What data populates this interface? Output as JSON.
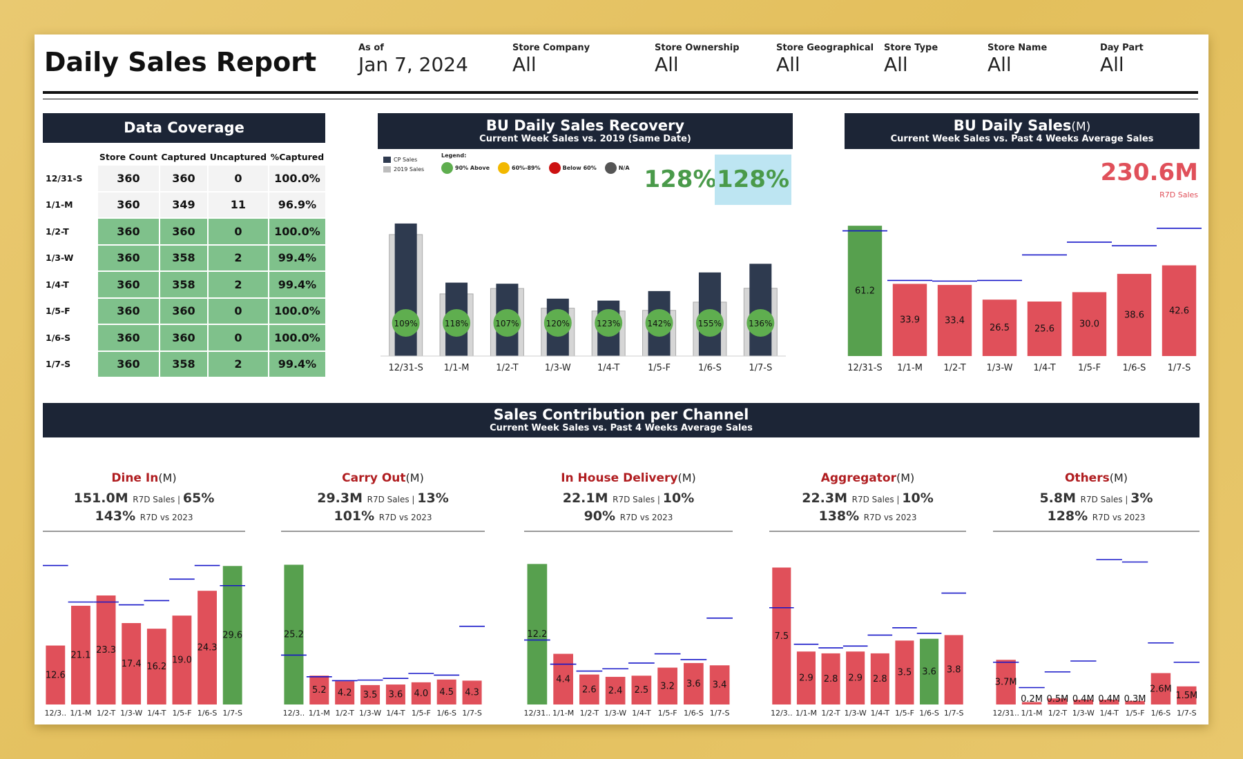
{
  "header": {
    "title": "Daily Sales Report",
    "filters": [
      {
        "label": "As of",
        "value": "Jan 7, 2024"
      },
      {
        "label": "Store Company",
        "value": "All"
      },
      {
        "label": "Store Ownership",
        "value": "All"
      },
      {
        "label": "Store Geographical",
        "value": "All"
      },
      {
        "label": "Store Type",
        "value": "All"
      },
      {
        "label": "Store Name",
        "value": "All"
      },
      {
        "label": "Day Part",
        "value": "All"
      }
    ]
  },
  "coverage": {
    "title": "Data Coverage",
    "columns": [
      "Store Count",
      "Captured",
      "Uncaptured",
      "%Captured"
    ],
    "rows": [
      {
        "day": "12/31-S",
        "values": [
          "360",
          "360",
          "0",
          "100.0%"
        ],
        "highlight": false
      },
      {
        "day": "1/1-M",
        "values": [
          "360",
          "349",
          "11",
          "96.9%"
        ],
        "highlight": false
      },
      {
        "day": "1/2-T",
        "values": [
          "360",
          "360",
          "0",
          "100.0%"
        ],
        "highlight": true
      },
      {
        "day": "1/3-W",
        "values": [
          "360",
          "358",
          "2",
          "99.4%"
        ],
        "highlight": true
      },
      {
        "day": "1/4-T",
        "values": [
          "360",
          "358",
          "2",
          "99.4%"
        ],
        "highlight": true
      },
      {
        "day": "1/5-F",
        "values": [
          "360",
          "360",
          "0",
          "100.0%"
        ],
        "highlight": true
      },
      {
        "day": "1/6-S",
        "values": [
          "360",
          "360",
          "0",
          "100.0%"
        ],
        "highlight": true
      },
      {
        "day": "1/7-S",
        "values": [
          "360",
          "358",
          "2",
          "99.4%"
        ],
        "highlight": true
      }
    ]
  },
  "recovery": {
    "title": "BU Daily Sales Recovery",
    "subtitle": "Current Week Sales vs. 2019 (Same Date)",
    "kpi_left": "128%",
    "kpi_right": "128%",
    "series_legend": [
      "CP Sales",
      "2019 Sales"
    ],
    "legend_title": "Legend:",
    "legend_items": [
      {
        "label": "90% Above",
        "color": "#5fae4f"
      },
      {
        "label": "60%-89%",
        "color": "#f2b800"
      },
      {
        "label": "Below 60%",
        "color": "#cc1111"
      },
      {
        "label": "N/A",
        "color": "#555555"
      }
    ]
  },
  "daily_sales": {
    "title": "BU Daily Sales",
    "unit": "(M)",
    "subtitle": "Current Week Sales vs. Past 4 Weeks Average Sales",
    "kpi": "230.6M",
    "kpi_label": "R7D Sales"
  },
  "channels_section": {
    "title": "Sales Contribution per Channel",
    "subtitle": "Current Week Sales vs. Past 4 Weeks Average Sales"
  },
  "channels": [
    {
      "name": "Dine In",
      "unit": "(M)",
      "sales": "151.0M",
      "sales_label": "R7D Sales",
      "share": "65%",
      "vs": "143%",
      "vs_label": "R7D vs 2023"
    },
    {
      "name": "Carry Out",
      "unit": "(M)",
      "sales": "29.3M",
      "sales_label": "R7D Sales",
      "share": "13%",
      "vs": "101%",
      "vs_label": "R7D vs 2023"
    },
    {
      "name": "In House Delivery",
      "unit": "(M)",
      "sales": "22.1M",
      "sales_label": "R7D Sales",
      "share": "10%",
      "vs": "90%",
      "vs_label": "R7D vs 2023"
    },
    {
      "name": "Aggregator",
      "unit": "(M)",
      "sales": "22.3M",
      "sales_label": "R7D Sales",
      "share": "10%",
      "vs": "138%",
      "vs_label": "R7D vs 2023"
    },
    {
      "name": "Others",
      "unit": "(M)",
      "sales": "5.8M",
      "sales_label": "R7D Sales",
      "share": "3%",
      "vs": "128%",
      "vs_label": "R7D vs 2023"
    }
  ],
  "chart_data": [
    {
      "id": "recovery",
      "type": "bar",
      "title": "BU Daily Sales Recovery",
      "categories": [
        "12/31-S",
        "1/1-M",
        "1/2-T",
        "1/3-W",
        "1/4-T",
        "1/5-F",
        "1/6-S",
        "1/7-S"
      ],
      "series": [
        {
          "name": "CP Sales",
          "values": [
            61.2,
            33.9,
            33.4,
            26.5,
            25.6,
            30.0,
            38.6,
            42.6
          ],
          "color": "#2e3a4f"
        },
        {
          "name": "2019 Sales",
          "values": [
            56.1,
            28.7,
            31.2,
            22.1,
            20.8,
            21.1,
            24.9,
            31.3
          ],
          "color": "#d4d4d4"
        }
      ],
      "labels": [
        "109%",
        "118%",
        "107%",
        "120%",
        "123%",
        "142%",
        "155%",
        "136%"
      ],
      "label_color": "#5fae4f",
      "ylim": [
        0,
        65
      ]
    },
    {
      "id": "daily",
      "type": "bar",
      "title": "BU Daily Sales",
      "categories": [
        "12/31-S",
        "1/1-M",
        "1/2-T",
        "1/3-W",
        "1/4-T",
        "1/5-F",
        "1/6-S",
        "1/7-S"
      ],
      "values": [
        61.2,
        33.9,
        33.4,
        26.5,
        25.6,
        30.0,
        38.6,
        42.6
      ],
      "labels": [
        "61.2",
        "33.9",
        "33.4",
        "26.5",
        "25.6",
        "30.0",
        "38.6",
        "42.6"
      ],
      "reference": [
        58.8,
        35.5,
        35.2,
        35.5,
        47.5,
        53.5,
        51.8,
        60.0
      ],
      "colors": [
        "#57a04e",
        "#e0505a",
        "#e0505a",
        "#e0505a",
        "#e0505a",
        "#e0505a",
        "#e0505a",
        "#e0505a"
      ],
      "ylim": [
        0,
        70
      ]
    },
    {
      "id": "dinein",
      "type": "bar",
      "categories": [
        "12/3..",
        "1/1-M",
        "1/2-T",
        "1/3-W",
        "1/4-T",
        "1/5-F",
        "1/6-S",
        "1/7-S"
      ],
      "values": [
        12.6,
        21.1,
        23.3,
        17.4,
        16.2,
        19.0,
        24.3,
        29.6
      ],
      "labels": [
        "12.6",
        "21.1",
        "23.3",
        "17.4",
        "16.2",
        "19.0",
        "24.3",
        "29.6"
      ],
      "reference": [
        29.7,
        21.9,
        21.9,
        21.3,
        22.2,
        26.8,
        29.7,
        25.4
      ],
      "colors": [
        "#e0505a",
        "#e0505a",
        "#e0505a",
        "#e0505a",
        "#e0505a",
        "#e0505a",
        "#e0505a",
        "#57a04e"
      ],
      "ylim": [
        0,
        32
      ]
    },
    {
      "id": "carryout",
      "type": "bar",
      "categories": [
        "12/3..",
        "1/1-M",
        "1/2-T",
        "1/3-W",
        "1/4-T",
        "1/5-F",
        "1/6-S",
        "1/7-S"
      ],
      "values": [
        25.2,
        5.2,
        4.2,
        3.5,
        3.6,
        4.0,
        4.5,
        4.3
      ],
      "labels": [
        "25.2",
        "5.2",
        "4.2",
        "3.5",
        "3.6",
        "4.0",
        "4.5",
        "4.3"
      ],
      "reference": [
        8.9,
        5.0,
        4.3,
        4.4,
        4.7,
        5.6,
        5.3,
        14.1
      ],
      "colors": [
        "#57a04e",
        "#e0505a",
        "#e0505a",
        "#e0505a",
        "#e0505a",
        "#e0505a",
        "#e0505a",
        "#e0505a"
      ],
      "ylim": [
        0,
        27
      ]
    },
    {
      "id": "inhouse",
      "type": "bar",
      "categories": [
        "12/31..",
        "1/1-M",
        "1/2-T",
        "1/3-W",
        "1/4-T",
        "1/5-F",
        "1/6-S",
        "1/7-S"
      ],
      "values": [
        12.2,
        4.4,
        2.6,
        2.4,
        2.5,
        3.2,
        3.6,
        3.4
      ],
      "labels": [
        "12.2",
        "4.4",
        "2.6",
        "2.4",
        "2.5",
        "3.2",
        "3.6",
        "3.4"
      ],
      "reference": [
        5.6,
        3.5,
        2.9,
        3.1,
        3.6,
        4.4,
        3.9,
        7.5
      ],
      "colors": [
        "#57a04e",
        "#e0505a",
        "#e0505a",
        "#e0505a",
        "#e0505a",
        "#e0505a",
        "#e0505a",
        "#e0505a"
      ],
      "ylim": [
        0,
        13
      ]
    },
    {
      "id": "aggregator",
      "type": "bar",
      "categories": [
        "12/3..",
        "1/1-M",
        "1/2-T",
        "1/3-W",
        "1/4-T",
        "1/5-F",
        "1/6-S",
        "1/7-S"
      ],
      "values": [
        7.5,
        2.9,
        2.8,
        2.9,
        2.8,
        3.5,
        3.6,
        3.8
      ],
      "labels": [
        "7.5",
        "2.9",
        "2.8",
        "2.9",
        "2.8",
        "3.5",
        "3.6",
        "3.8"
      ],
      "reference": [
        5.3,
        3.3,
        3.1,
        3.2,
        3.8,
        4.2,
        3.9,
        6.1
      ],
      "colors": [
        "#e0505a",
        "#e0505a",
        "#e0505a",
        "#e0505a",
        "#e0505a",
        "#e0505a",
        "#57a04e",
        "#e0505a"
      ],
      "ylim": [
        0,
        8.2
      ]
    },
    {
      "id": "others",
      "type": "bar",
      "categories": [
        "12/31..",
        "1/1-M",
        "1/2-T",
        "1/3-W",
        "1/4-T",
        "1/5-F",
        "1/6-S",
        "1/7-S"
      ],
      "values": [
        3.7,
        0.2,
        0.5,
        0.4,
        0.4,
        0.3,
        2.6,
        1.5
      ],
      "labels": [
        "3.7M",
        "0.2M",
        "0.5M",
        "0.4M",
        "0.4M",
        "0.3M",
        "2.6M",
        "1.5M"
      ],
      "reference": [
        3.5,
        1.4,
        2.7,
        3.6,
        12.0,
        11.8,
        5.1,
        3.5
      ],
      "colors": [
        "#e0505a",
        "#e0505a",
        "#e0505a",
        "#e0505a",
        "#e0505a",
        "#e0505a",
        "#e0505a",
        "#e0505a"
      ],
      "ylim": [
        0,
        12.4
      ]
    }
  ]
}
